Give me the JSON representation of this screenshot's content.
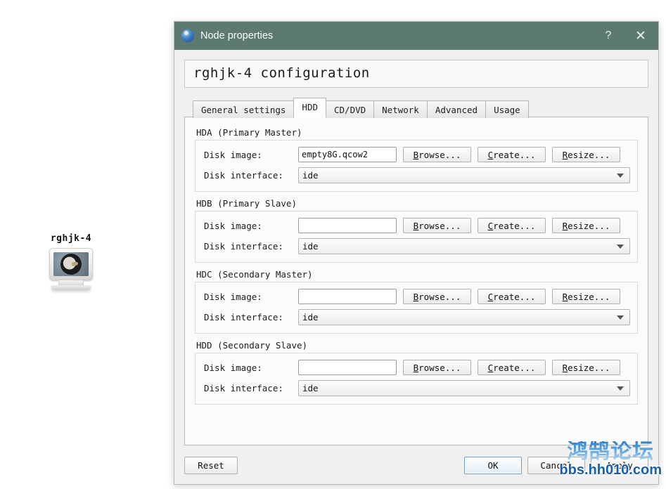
{
  "desktop": {
    "node": {
      "label": "rghjk-4",
      "icon": "computer-monitor-icon"
    }
  },
  "dialog": {
    "titlebar": {
      "icon": "app-globe-icon",
      "title": "Node properties",
      "help_label": "?",
      "close_label": "✕"
    },
    "config_header": "rghjk-4 configuration",
    "tabs": [
      {
        "label": "General settings",
        "selected": false
      },
      {
        "label": "HDD",
        "selected": true
      },
      {
        "label": "CD/DVD",
        "selected": false
      },
      {
        "label": "Network",
        "selected": false
      },
      {
        "label": "Advanced",
        "selected": false
      },
      {
        "label": "Usage",
        "selected": false
      }
    ],
    "labels": {
      "disk_image": "Disk image:",
      "disk_interface": "Disk interface:"
    },
    "buttons": {
      "browse": "Browse...",
      "browse_mnemonic": "B",
      "create": "Create...",
      "create_mnemonic": "C",
      "resize": "Resize...",
      "resize_mnemonic": "R"
    },
    "groups": [
      {
        "title": "HDA (Primary Master)",
        "disk_image": "empty8G.qcow2",
        "disk_image_placeholder": "",
        "disk_interface": "ide"
      },
      {
        "title": "HDB (Primary Slave)",
        "disk_image": "",
        "disk_image_placeholder": "",
        "disk_interface": "ide"
      },
      {
        "title": "HDC (Secondary Master)",
        "disk_image": "",
        "disk_image_placeholder": "",
        "disk_interface": "ide"
      },
      {
        "title": "HDD (Secondary Slave)",
        "disk_image": "",
        "disk_image_placeholder": "",
        "disk_interface": "ide"
      }
    ],
    "footer": {
      "reset": "Reset",
      "ok": "OK",
      "cancel": "Cancel",
      "apply": "Apply"
    }
  },
  "watermark": {
    "cn": "鸿鹄论坛",
    "url": "bbs.hh010.com"
  },
  "colors": {
    "titlebar": "#5c7a72",
    "dialog_bg": "#f0f0f0",
    "panel_bg": "#fbfbfb",
    "default_button_border": "#6d9fc4",
    "watermark_blue": "#1a5fa8"
  }
}
